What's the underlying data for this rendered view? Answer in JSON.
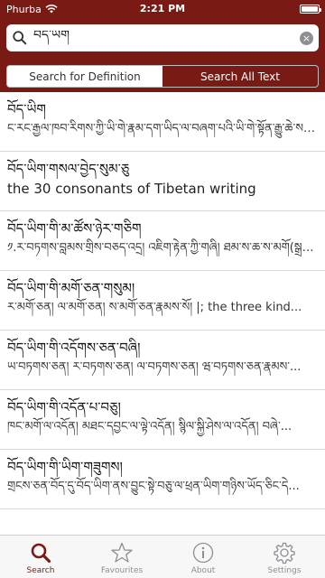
{
  "status": {
    "carrier": "Phurba",
    "time": "2:21 PM"
  },
  "search": {
    "value": "བོད་ཡིག",
    "clear_icon": "×"
  },
  "segments": [
    {
      "label": "Search for Definition",
      "active": false
    },
    {
      "label": "Search All Text",
      "active": true
    }
  ],
  "results": [
    {
      "title": "བོད་ཡིག",
      "sub": "ང་རང་རྒྱལ་ཁབ་རིགས་ཀྱི་ཡི་གེ་རྣམ་དག་ཡིད་ལ་བཞག་པའི་ཡི་གེ་སྟོན་རྒྱུ་ཆེ་ས་..."
    },
    {
      "title": "བོད་ཡིག་གསལ་བྱེད་སུམ་ཅུ",
      "sub": "the 30 consonants of Tibetan writing",
      "en": true
    },
    {
      "title": "བོད་ཡིག་གི་མ་ཚོས་ཉེར་གཅིག",
      "sub": "༡.ར་བཏགས་བླམས་གྲིས་བཅད་འདྲ། འཇིག་རྟེན་ཀྱི་གཞི། ཐམ་ས་ཆ་ས་མགོ(སྒྲ་གསུམ)..."
    },
    {
      "title": "བོད་ཡིག་གི་མགོ་ཅན་གསུམ།",
      "sub": "ར་མགོ་ཅན། ལ་མགོ་ཅན། ས་མགོ་ཅན་རྣམས་སོ། |; the three kind..."
    },
    {
      "title": "བོད་ཡིག་གི་འདོགས་ཅན་བཞི།",
      "sub": "ཡ་བཏགས་ཅན། ར་བཏགས་ཅན། ལ་བཏགས་ཅན། ཝ་བཏགས་ཅན་རྣམས་..."
    },
    {
      "title": "བོད་ཡིག་གི་འདོན་པ་བཅུ།",
      "sub": "ཁང་མགོ་ལ་འདོན། མཐང་དབྱང་ལ་ལྟེ་འདོན། སྙིལ་སྐྱི་ཤེས་ལ་འདོན། བཞེ་..."
    },
    {
      "title": "བོད་ཡིག་གི་ཡིག་གཟུགས།",
      "sub": "གྲངས་ཅན་བོད་དུ་བོད་ཡིག་ནས་བྱུང་སྟེ་བཅུ་ལ་ཕྲན་ཡིག་གཉིས་ཡོད་ཅིང་དེ..."
    }
  ],
  "tabs": [
    {
      "label": "Search",
      "icon": "search-icon",
      "active": true
    },
    {
      "label": "Favourites",
      "icon": "star-icon",
      "active": false
    },
    {
      "label": "About",
      "icon": "info-icon",
      "active": false
    },
    {
      "label": "Settings",
      "icon": "gear-icon",
      "active": false
    }
  ]
}
